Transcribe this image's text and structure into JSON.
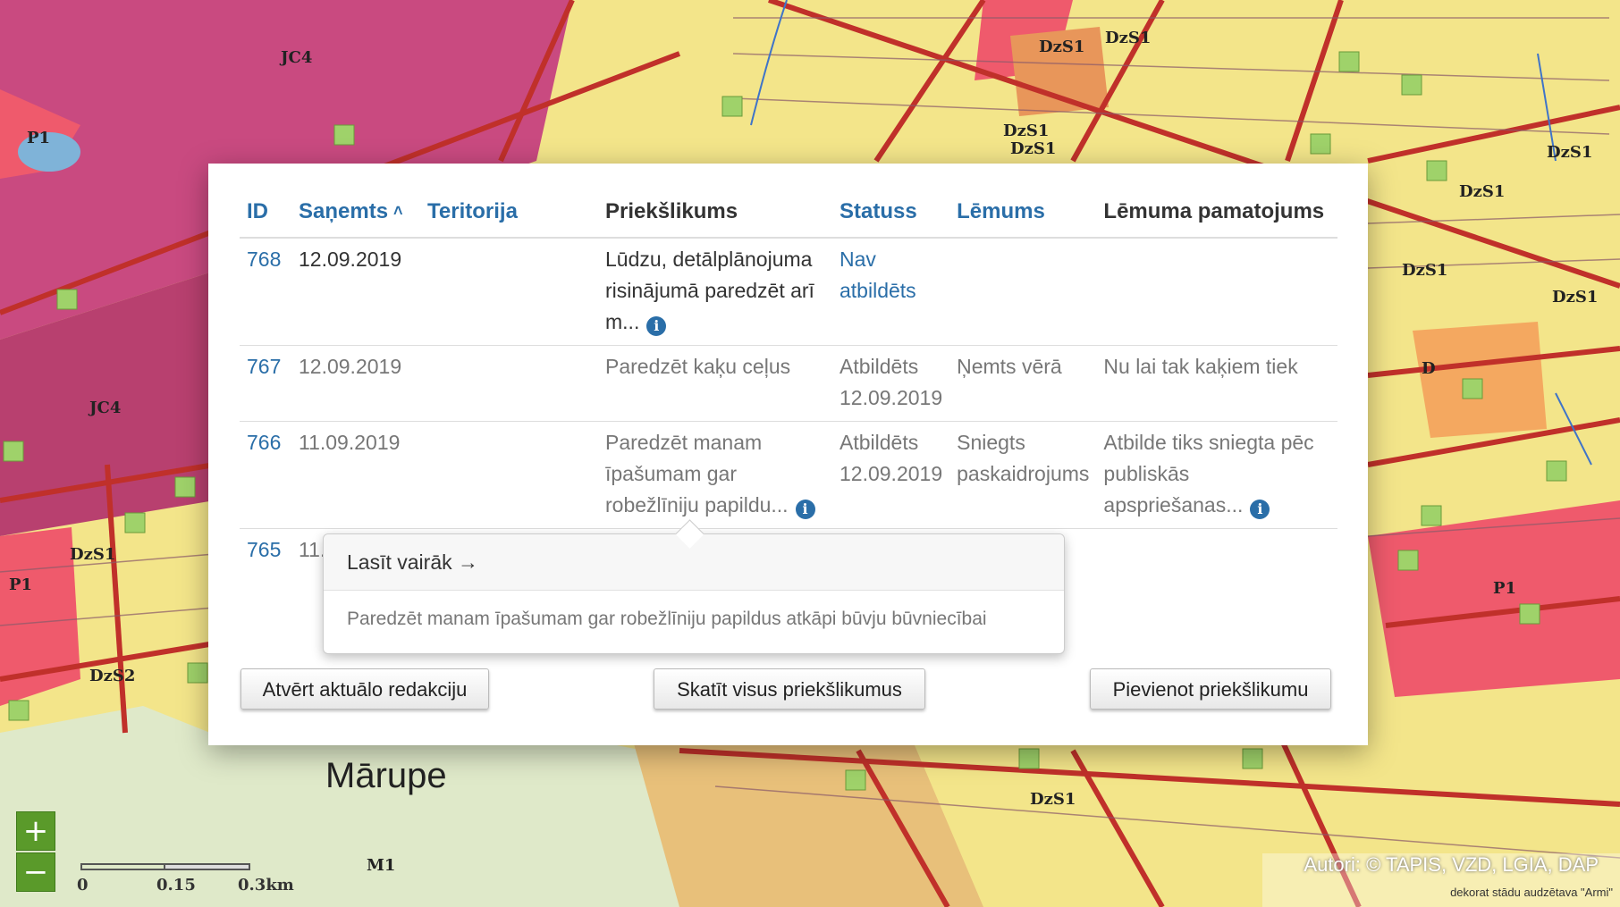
{
  "map": {
    "zones": [
      "P1",
      "JC4",
      "JC4",
      "DzS1",
      "DzS1",
      "DzS1",
      "DzS1",
      "DzS1",
      "DzS1",
      "DzS1",
      "DzS1",
      "DzS1",
      "DzS1",
      "DzS2",
      "P1",
      "P1",
      "M1",
      "D"
    ],
    "place_name": "Mārupe",
    "scale": {
      "labels": [
        "0",
        "0.15",
        "0.3km"
      ]
    },
    "zoom_in": "+",
    "zoom_out": "−",
    "attribution": "Autori: © TAPIS, VZD, LGIA, DAP",
    "attribution_sub": "dekorat stādu audzētava \"Armi\""
  },
  "table": {
    "headers": [
      "ID",
      "Saņemts",
      "Teritorija",
      "Priekšlikums",
      "Statuss",
      "Lēmums",
      "Lēmuma pamatojums"
    ],
    "sort_indicator": "^",
    "rows": [
      {
        "id": "768",
        "date": "12.09.2019",
        "territory": "",
        "proposal": "Lūdzu, detālplānojuma risinājumā paredzēt arī m...",
        "status": "Nav atbildēts",
        "decision": "",
        "justification": ""
      },
      {
        "id": "767",
        "date": "12.09.2019",
        "territory": "",
        "proposal": "Paredzēt kaķu ceļus",
        "status": "Atbildēts 12.09.2019",
        "decision": "Ņemts vērā",
        "justification": "Nu lai tak kaķiem tiek"
      },
      {
        "id": "766",
        "date": "11.09.2019",
        "territory": "",
        "proposal": "Paredzēt manam īpašumam gar robežlīniju papildu...",
        "status": "Atbildēts 12.09.2019",
        "decision": "Sniegts paskaidrojums",
        "justification": "Atbilde tiks sniegta pēc publiskās apspriešanas..."
      },
      {
        "id": "765",
        "date": "11.",
        "territory": "",
        "proposal": "",
        "status": "",
        "decision": "",
        "justification": ""
      }
    ],
    "info_icon": "i"
  },
  "buttons": {
    "open": "Atvērt aktuālo redakciju",
    "view_all": "Skatīt visus priekšlikumus",
    "add": "Pievienot priekšlikumu"
  },
  "popover": {
    "title": "Lasīt vairāk →",
    "body": "Paredzēt manam īpašumam gar robežlīniju papildus atkāpi būvju būvniecībai"
  },
  "colors": {
    "residential": "#f7ec7a",
    "commercial": "#c8447a",
    "public": "#ef5a6c",
    "forest": "#dde8c8",
    "link": "#2a6ea8",
    "accent_green": "#5a9a2a"
  }
}
